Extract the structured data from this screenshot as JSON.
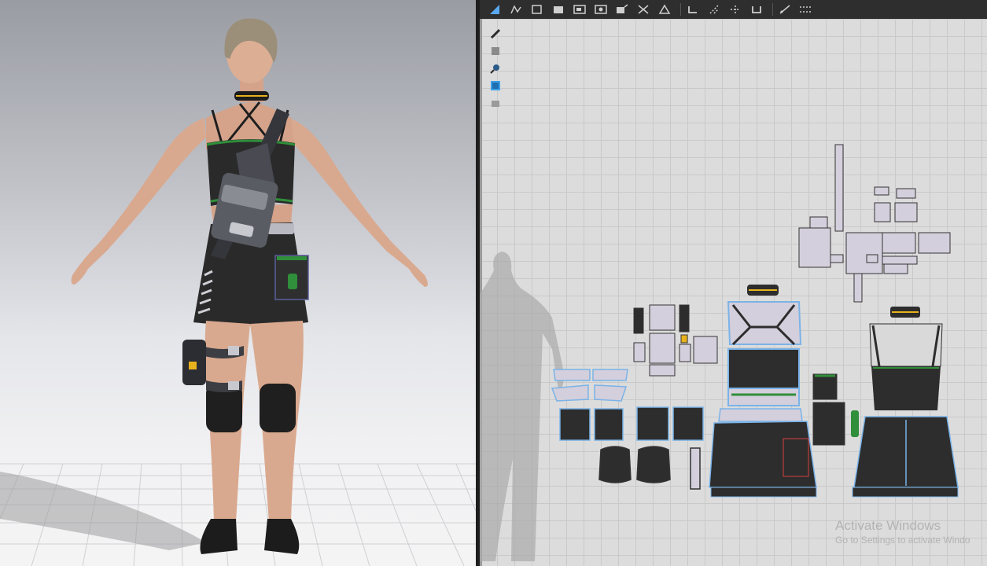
{
  "toolbar": {
    "tools": [
      "select-pattern-icon",
      "edit-pattern-icon",
      "transform-icon",
      "rectangle-icon",
      "polygon-icon",
      "internal-polygon-icon",
      "fold-icon",
      "sew-icon",
      "segment-sewing-icon",
      "undo-icon",
      "redo-icon",
      "sewing-tool-icon",
      "free-sewing-icon",
      "measure-icon",
      "line-icon"
    ]
  },
  "side_tools": [
    "pin-icon",
    "show-pattern-icon",
    "zoom-pattern-icon",
    "texture-icon",
    "arrange-icon"
  ],
  "colors": {
    "garment": "#2a2a2a",
    "pattern_fill_dark": "#2d2d2d",
    "pattern_fill_light": "#d4cfdc",
    "pattern_outline_selected": "#7ab3e8",
    "accent_green": "#2f8f3a",
    "accent_yellow": "#e8b21c"
  },
  "watermark": {
    "title": "Activate Windows",
    "subtitle": "Go to Settings to activate Windo"
  }
}
